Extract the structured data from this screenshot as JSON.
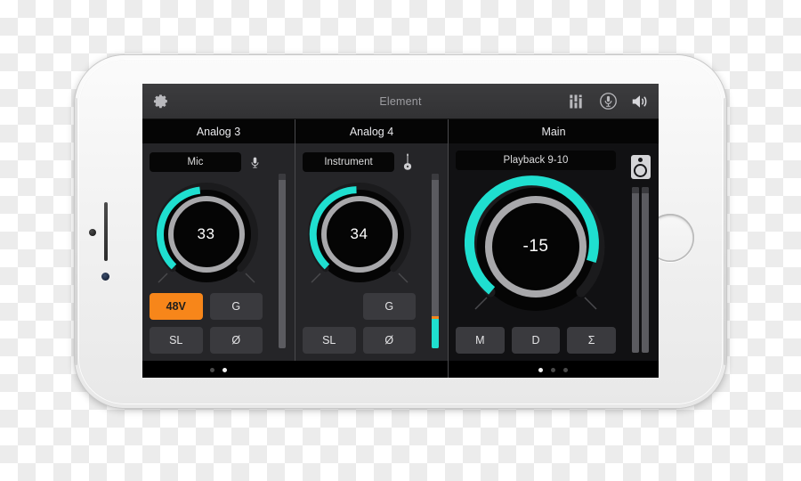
{
  "app": {
    "title": "Element",
    "accent_cyan": "#1fdfd0",
    "accent_orange": "#f7861a"
  },
  "header": {
    "settings_icon": "gear-icon",
    "right_icons": [
      {
        "name": "mixer-faders-icon",
        "label": "Mixer"
      },
      {
        "name": "microphone-circle-icon",
        "label": "Mic"
      },
      {
        "name": "speaker-volume-icon",
        "label": "Volume"
      }
    ]
  },
  "channels": [
    {
      "name": "Analog 3",
      "source": "Mic",
      "source_icon": "microphone-icon",
      "knob": {
        "value": "33",
        "arc_start_deg": 227,
        "arc_end_deg": 352
      },
      "buttons": [
        {
          "label": "48V",
          "active": true
        },
        {
          "label": "G",
          "active": false
        },
        {
          "label": "SL",
          "active": false
        },
        {
          "label": "Ø",
          "active": false
        }
      ],
      "meter": {
        "level_pct": 0,
        "peak_pct": null
      },
      "page_dots": {
        "count": 2,
        "active": 1
      }
    },
    {
      "name": "Analog 4",
      "source": "Instrument",
      "source_icon": "guitar-icon",
      "knob": {
        "value": "34",
        "arc_start_deg": 227,
        "arc_end_deg": 355
      },
      "buttons": [
        {
          "label": "",
          "active": false
        },
        {
          "label": "G",
          "active": false
        },
        {
          "label": "SL",
          "active": false
        },
        {
          "label": "Ø",
          "active": false
        }
      ],
      "meter": {
        "level_pct": 17,
        "peak_pct": 18
      },
      "page_dots": {
        "count": 0,
        "active": -1
      }
    },
    {
      "name": "Main",
      "source": "Playback 9-10",
      "source_icon": "monitor-speaker-icon",
      "knob": {
        "value": "-15",
        "arc_start_deg": 222,
        "arc_end_deg": 438
      },
      "buttons": [
        {
          "label": "M",
          "active": false
        },
        {
          "label": "D",
          "active": false
        },
        {
          "label": "Σ",
          "active": false
        }
      ],
      "meter": {
        "level_pct": 0,
        "peak_pct": null
      },
      "page_dots": {
        "count": 3,
        "active": 0
      }
    }
  ]
}
